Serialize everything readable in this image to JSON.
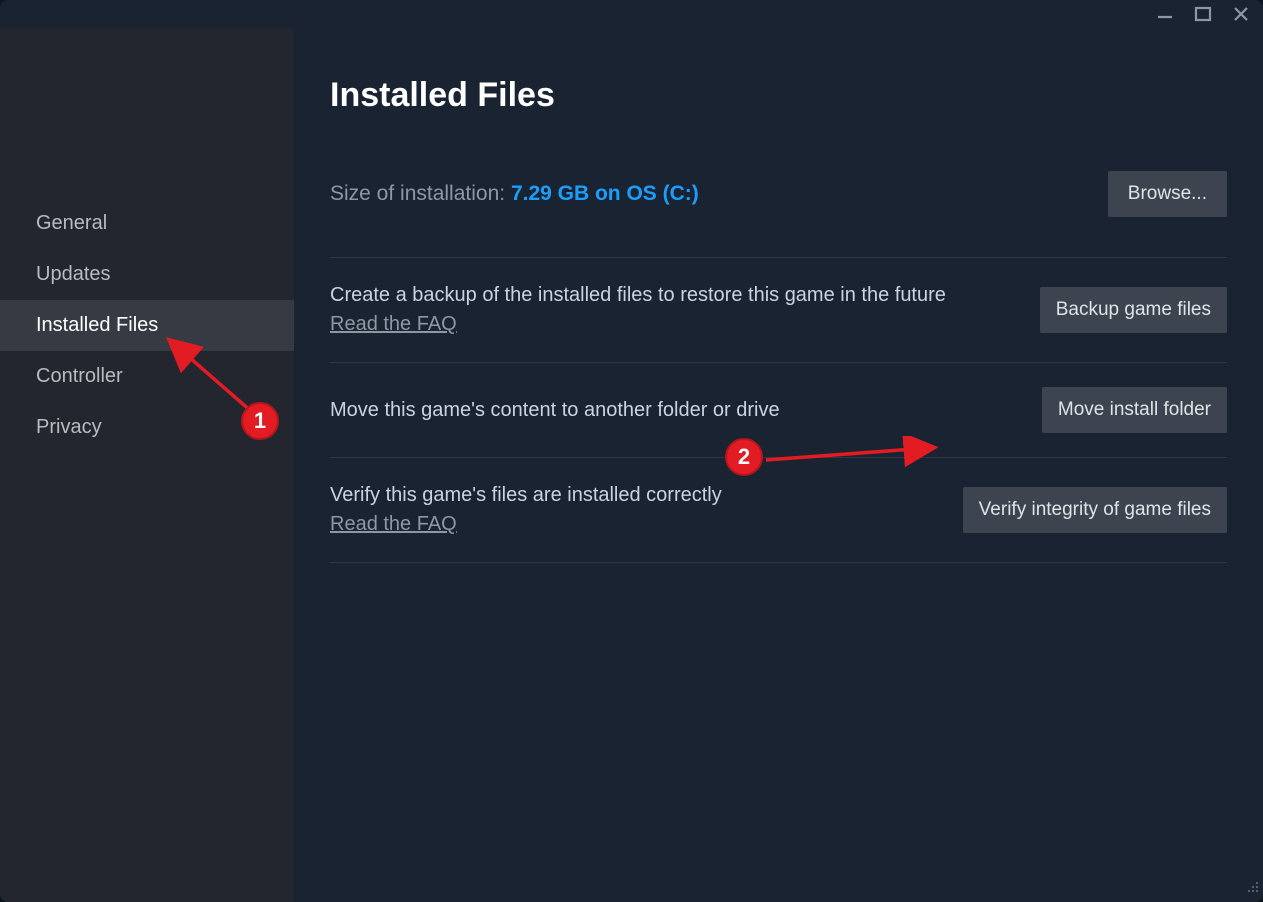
{
  "sidebar": {
    "items": [
      {
        "label": "General"
      },
      {
        "label": "Updates"
      },
      {
        "label": "Installed Files"
      },
      {
        "label": "Controller"
      },
      {
        "label": "Privacy"
      }
    ],
    "active_index": 2
  },
  "page": {
    "title": "Installed Files",
    "size_label_prefix": "Size of installation: ",
    "size_value": "7.29 GB on OS (C:)",
    "browse_button": "Browse..."
  },
  "rows": {
    "backup": {
      "desc": "Create a backup of the installed files to restore this game in the future",
      "faq": "Read the FAQ",
      "button": "Backup game files"
    },
    "move": {
      "desc": "Move this game's content to another folder or drive",
      "button": "Move install folder"
    },
    "verify": {
      "desc": "Verify this game's files are installed correctly",
      "faq": "Read the FAQ",
      "button": "Verify integrity of game files"
    }
  },
  "annotations": {
    "callout_1": "1",
    "callout_2": "2"
  }
}
